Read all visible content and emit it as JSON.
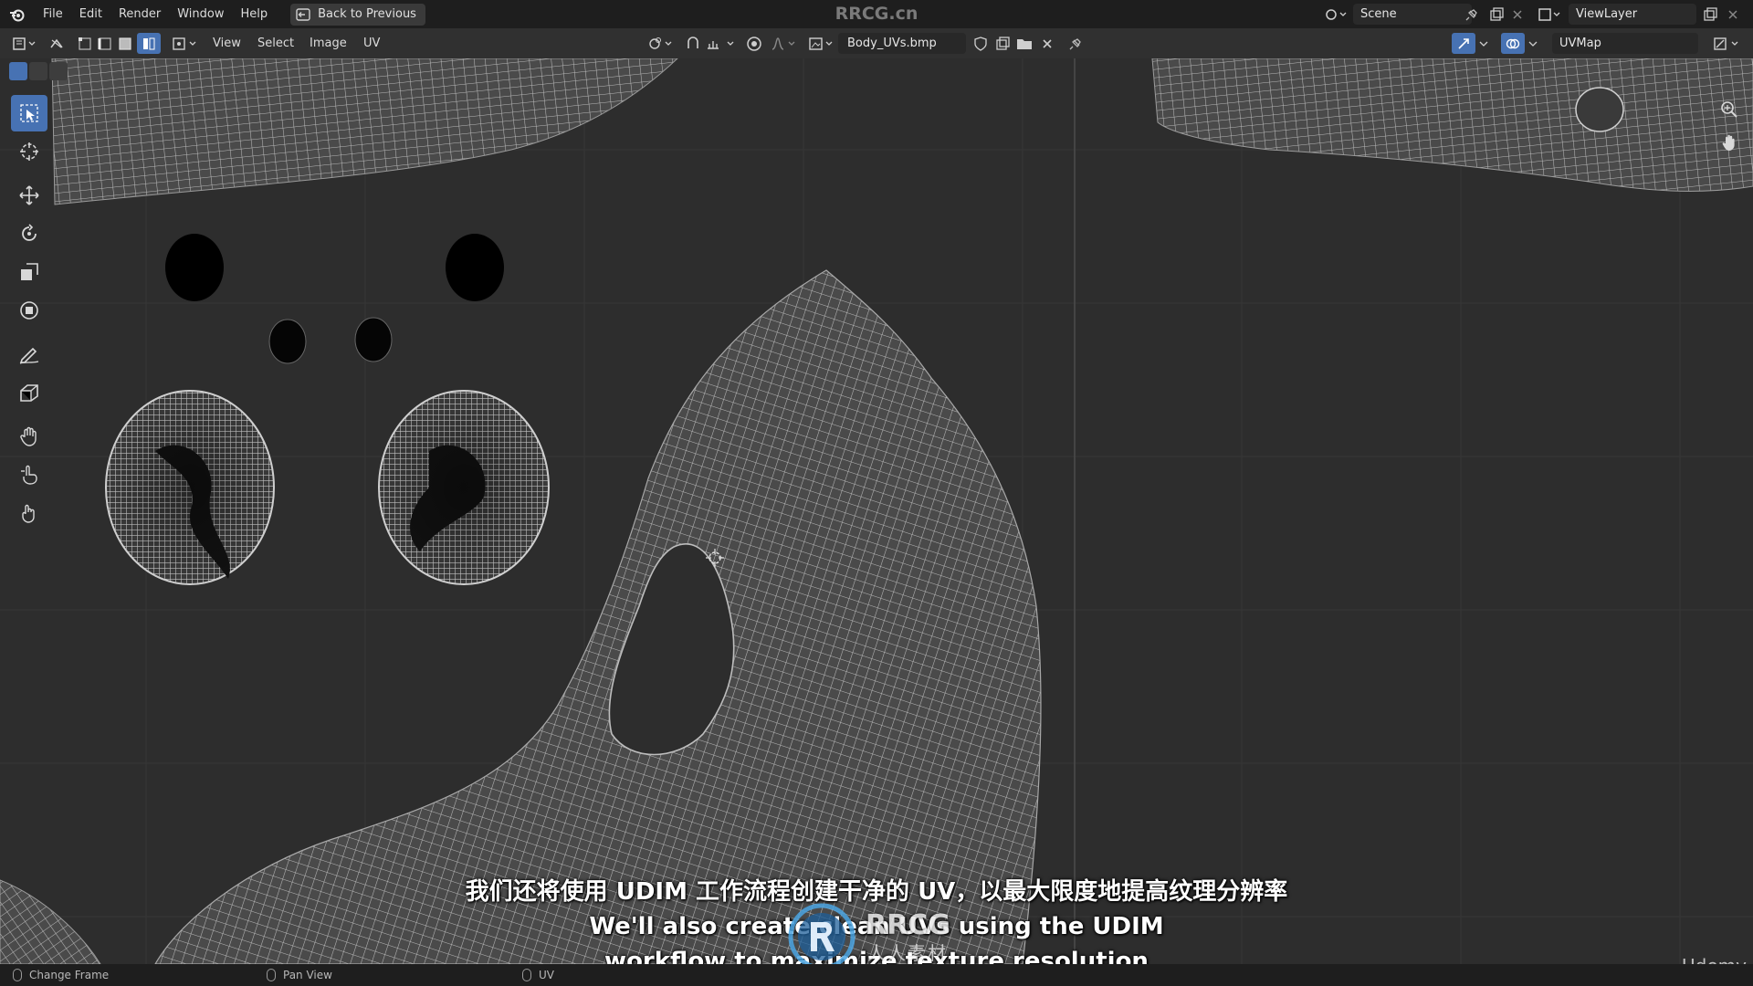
{
  "app": {
    "watermark_title": "RRCG.cn",
    "menu": [
      "File",
      "Edit",
      "Render",
      "Window",
      "Help"
    ],
    "back_button": "Back to Previous",
    "scene": "Scene",
    "view_layer": "ViewLayer"
  },
  "editor_header": {
    "menus": [
      "View",
      "Select",
      "Image",
      "UV"
    ],
    "image_name": "Body_UVs.bmp",
    "uv_map": "UVMap"
  },
  "toolbar": {
    "tools": [
      "select-box",
      "cursor",
      "move",
      "rotate",
      "scale",
      "transform",
      "annotate",
      "rip-region",
      "grab",
      "relax",
      "pinch"
    ],
    "active_tool": "select-box"
  },
  "status_bar": {
    "items": [
      "Change Frame",
      "Pan View",
      "UV"
    ]
  },
  "subtitles": {
    "zh": "我们还将使用 UDIM 工作流程创建干净的 UV，以最大限度地提高纹理分辨率",
    "en_line1": "We'll also create clean UVs using the UDIM",
    "en_line2": "workflow to maximize texture resolution"
  },
  "overlay": {
    "brand": "RRCG",
    "brand_sub": "人人素材",
    "platform": "Udemy"
  },
  "colors": {
    "accent": "#4772b3",
    "background": "#2d2d2d",
    "mesh_fill": "#4a4a4a",
    "mesh_line": "#bdbdbd"
  }
}
